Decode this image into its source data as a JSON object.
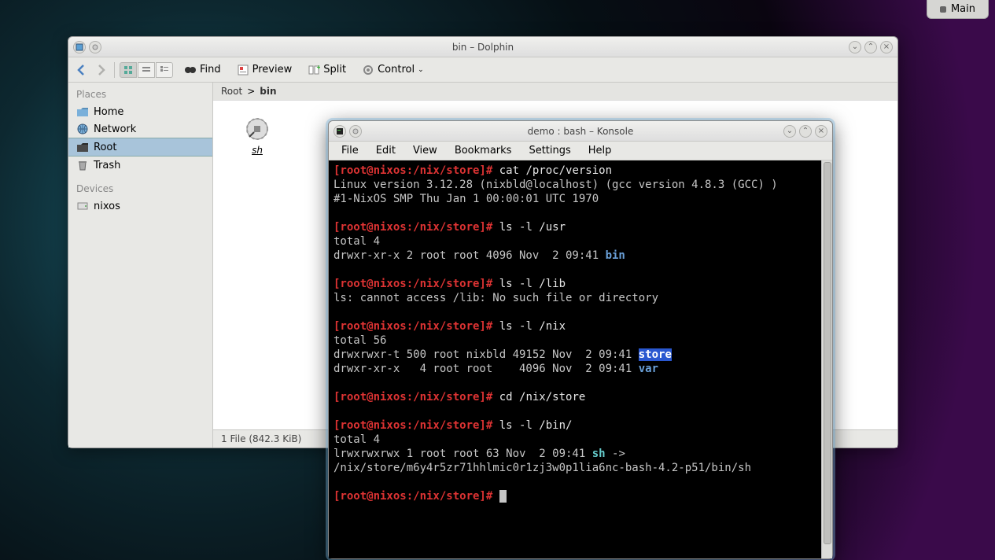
{
  "main_button": {
    "label": "Main"
  },
  "dolphin": {
    "title": "bin – Dolphin",
    "toolbar": {
      "find": "Find",
      "preview": "Preview",
      "split": "Split",
      "control": "Control"
    },
    "sidebar": {
      "places_heading": "Places",
      "devices_heading": "Devices",
      "places": [
        {
          "label": "Home"
        },
        {
          "label": "Network"
        },
        {
          "label": "Root"
        },
        {
          "label": "Trash"
        }
      ],
      "devices": [
        {
          "label": "nixos"
        }
      ]
    },
    "breadcrumb": {
      "root": "Root",
      "sep": ">",
      "current": "bin"
    },
    "file": {
      "label": "sh"
    },
    "status": "1 File (842.3 KiB)"
  },
  "konsole": {
    "title": "demo : bash – Konsole",
    "menu": {
      "file": "File",
      "edit": "Edit",
      "view": "View",
      "bookmarks": "Bookmarks",
      "settings": "Settings",
      "help": "Help"
    },
    "prompt": "[root@nixos:/nix/store]#",
    "lines": {
      "cmd1": "cat /proc/version",
      "out1a": "Linux version 3.12.28 (nixbld@localhost) (gcc version 4.8.3 (GCC) )",
      "out1b": "#1-NixOS SMP Thu Jan 1 00:00:01 UTC 1970",
      "cmd2": "ls -l /usr",
      "out2a": "total 4",
      "out2b_pre": "drwxr-xr-x 2 root root 4096 Nov  2 09:41 ",
      "out2b_dir": "bin",
      "cmd3": "ls -l /lib",
      "out3": "ls: cannot access /lib: No such file or directory",
      "cmd4": "ls -l /nix",
      "out4a": "total 56",
      "out4b_pre": "drwxrwxr-t 500 root nixbld 49152 Nov  2 09:41 ",
      "out4b_dir": "store",
      "out4c_pre": "drwxr-xr-x   4 root root    4096 Nov  2 09:41 ",
      "out4c_dir": "var",
      "cmd5": "cd /nix/store",
      "cmd6": "ls -l /bin/",
      "out6a": "total 4",
      "out6b_pre": "lrwxrwxrwx 1 root root 63 Nov  2 09:41 ",
      "out6b_link": "sh",
      "out6b_arrow": " -> /nix/store/m6y4r5zr71hhlmic0r1zj3w0p1lia6nc-bash-4.2-p51/bin/sh"
    }
  }
}
